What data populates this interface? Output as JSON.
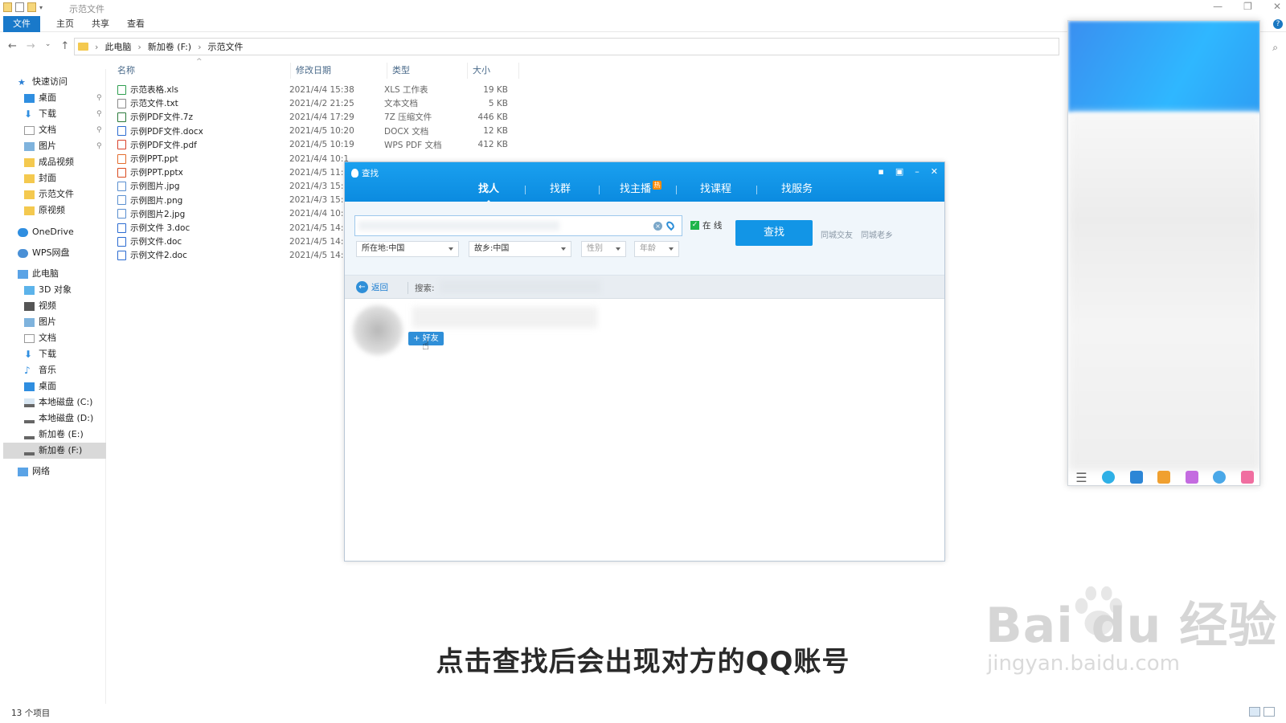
{
  "explorer": {
    "title": "示范文件",
    "ribbon_tabs": [
      "文件",
      "主页",
      "共享",
      "查看"
    ],
    "breadcrumb": [
      "此电脑",
      "新加卷 (F:)",
      "示范文件"
    ],
    "sidebar": [
      {
        "label": "快速访问",
        "icon": "star-icon"
      },
      {
        "label": "桌面",
        "icon": "desktop-icon"
      },
      {
        "label": "下载",
        "icon": "download-icon"
      },
      {
        "label": "文档",
        "icon": "document-icon"
      },
      {
        "label": "图片",
        "icon": "pictures-icon"
      },
      {
        "label": "成品视频",
        "icon": "folder-icon"
      },
      {
        "label": "封面",
        "icon": "folder-icon"
      },
      {
        "label": "示范文件",
        "icon": "folder-icon"
      },
      {
        "label": "原视频",
        "icon": "folder-icon"
      },
      {
        "label": "OneDrive",
        "icon": "cloud-icon"
      },
      {
        "label": "WPS网盘",
        "icon": "cloud-icon"
      },
      {
        "label": "此电脑",
        "icon": "computer-icon"
      },
      {
        "label": "3D 对象",
        "icon": "cube-icon"
      },
      {
        "label": "视频",
        "icon": "video-icon"
      },
      {
        "label": "图片",
        "icon": "pictures-icon"
      },
      {
        "label": "文档",
        "icon": "document-icon"
      },
      {
        "label": "下载",
        "icon": "download-icon"
      },
      {
        "label": "音乐",
        "icon": "music-icon"
      },
      {
        "label": "桌面",
        "icon": "desktop-icon"
      },
      {
        "label": "本地磁盘 (C:)",
        "icon": "drive-icon"
      },
      {
        "label": "本地磁盘 (D:)",
        "icon": "drive-icon"
      },
      {
        "label": "新加卷 (E:)",
        "icon": "drive-icon"
      },
      {
        "label": "新加卷 (F:)",
        "icon": "drive-icon"
      },
      {
        "label": "网络",
        "icon": "network-icon"
      }
    ],
    "columns": {
      "name": "名称",
      "date": "修改日期",
      "type": "类型",
      "size": "大小"
    },
    "files": [
      {
        "name": "示范表格.xls",
        "date": "2021/4/4 15:38",
        "type": "XLS 工作表",
        "size": "19 KB"
      },
      {
        "name": "示范文件.txt",
        "date": "2021/4/2 21:25",
        "type": "文本文档",
        "size": "5 KB"
      },
      {
        "name": "示例PDF文件.7z",
        "date": "2021/4/4 17:29",
        "type": "7Z 压缩文件",
        "size": "446 KB"
      },
      {
        "name": "示例PDF文件.docx",
        "date": "2021/4/5 10:20",
        "type": "DOCX 文档",
        "size": "12 KB"
      },
      {
        "name": "示例PDF文件.pdf",
        "date": "2021/4/5 10:19",
        "type": "WPS PDF 文档",
        "size": "412 KB"
      },
      {
        "name": "示例PPT.ppt",
        "date": "2021/4/4 10:1",
        "type": "",
        "size": ""
      },
      {
        "name": "示例PPT.pptx",
        "date": "2021/4/5 11:",
        "type": "",
        "size": ""
      },
      {
        "name": "示例图片.jpg",
        "date": "2021/4/3 15:",
        "type": "",
        "size": ""
      },
      {
        "name": "示例图片.png",
        "date": "2021/4/3 15:",
        "type": "",
        "size": ""
      },
      {
        "name": "示例图片2.jpg",
        "date": "2021/4/4 10:",
        "type": "",
        "size": ""
      },
      {
        "name": "示例文件 3.doc",
        "date": "2021/4/5 14:",
        "type": "",
        "size": ""
      },
      {
        "name": "示例文件.doc",
        "date": "2021/4/5 14:",
        "type": "",
        "size": ""
      },
      {
        "name": "示例文件2.doc",
        "date": "2021/4/5 14:",
        "type": "",
        "size": ""
      }
    ],
    "status": "13 个项目"
  },
  "qq_find": {
    "title": "查找",
    "tabs": [
      "找人",
      "找群",
      "找主播",
      "找课程",
      "找服务"
    ],
    "hot_badge": "热",
    "online_label": "在  线",
    "find_button": "查找",
    "links": [
      "同城交友",
      "同城老乡"
    ],
    "filters": {
      "location": "所在地:中国",
      "hometown": "故乡:中国",
      "gender": "性别",
      "age": "年龄"
    },
    "back_label": "返回",
    "search_label": "搜索:",
    "add_friend": "+ 好友"
  },
  "subtitle": "点击查找后会出现对方的QQ账号",
  "watermark": {
    "line1": "Bai  du 经验",
    "line2": "jingyan.baidu.com"
  },
  "colors": {
    "qq_blue": "#1295e6",
    "ribbon_file": "#1979ca"
  }
}
